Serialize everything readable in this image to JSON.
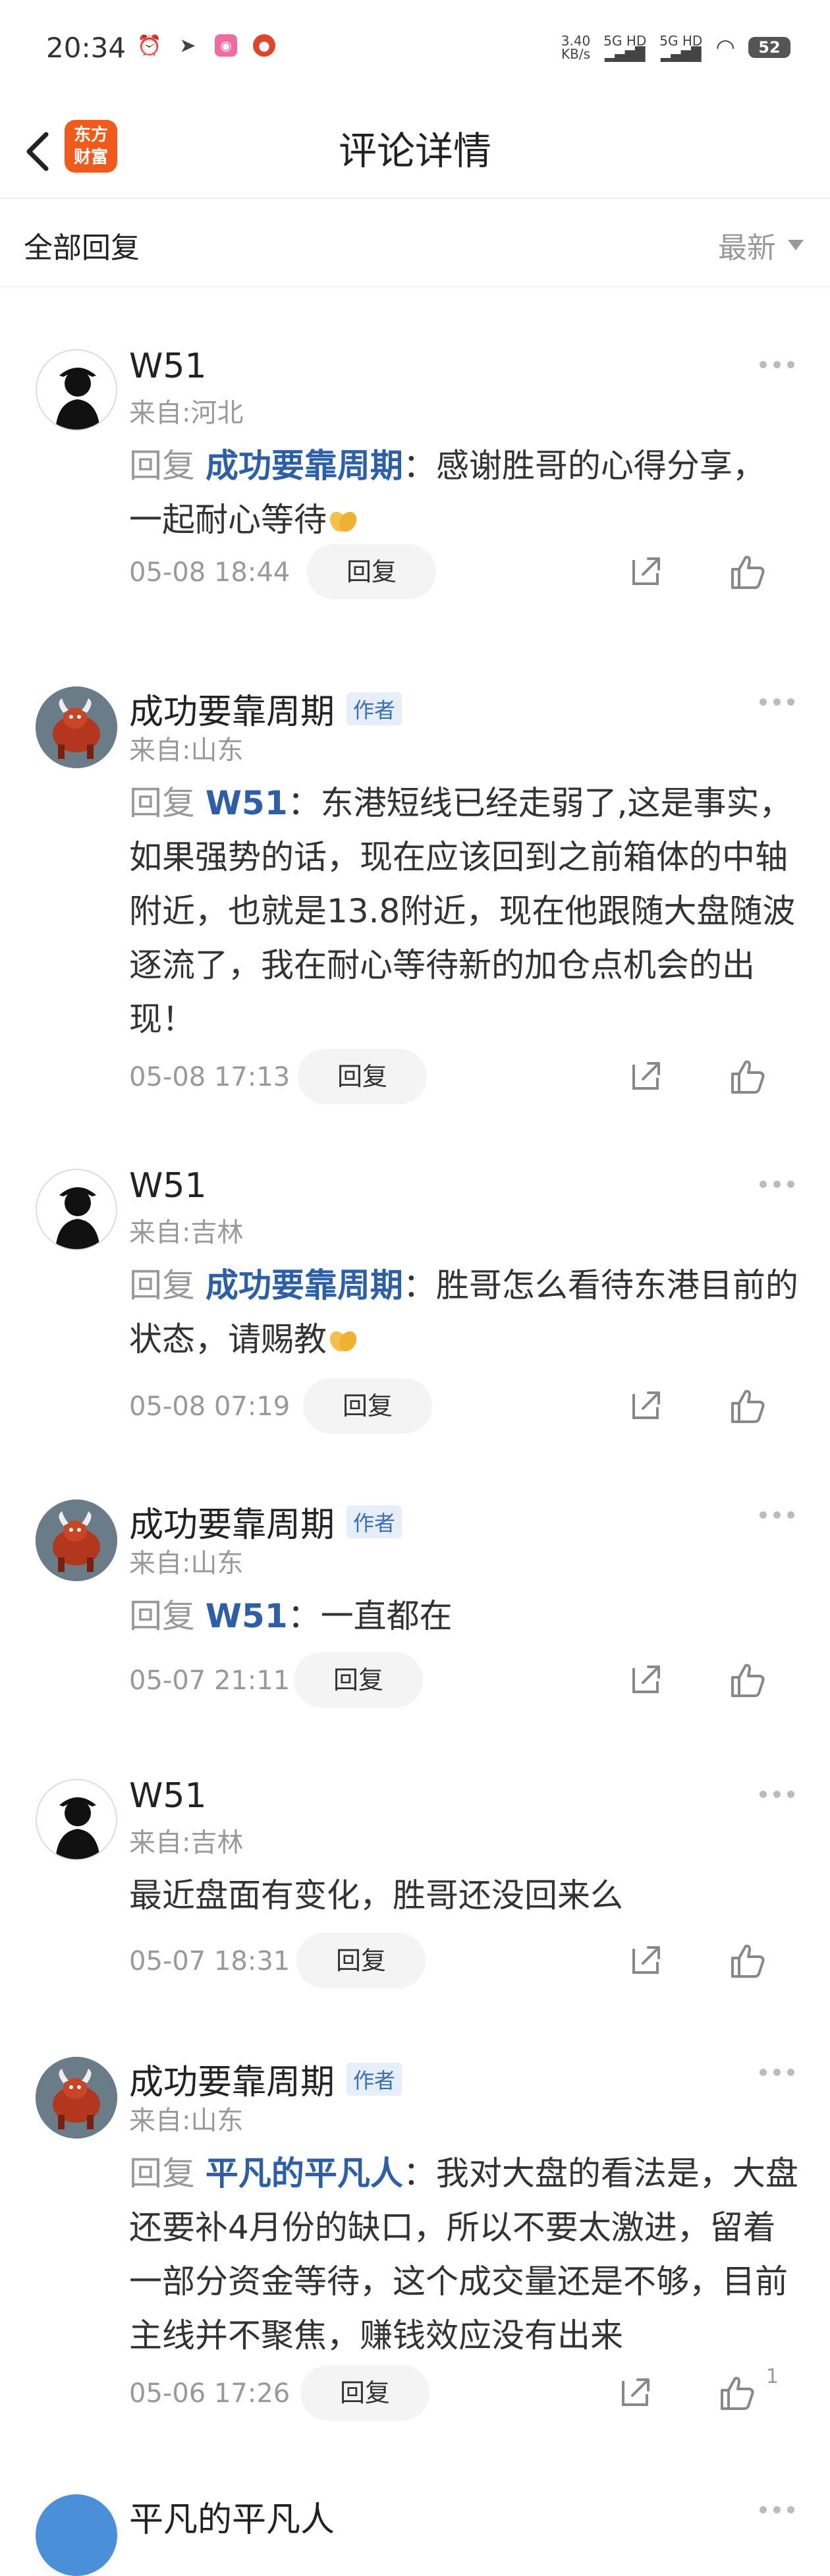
{
  "status_bar": {
    "time": "20:34",
    "speed_value": "3.40",
    "speed_unit": "KB/s",
    "net1": "5G HD",
    "net2": "5G HD",
    "battery": "52"
  },
  "nav": {
    "title": "评论详情",
    "logo_line1": "东方",
    "logo_line2": "财富"
  },
  "section": {
    "title": "全部回复",
    "sort_label": "最新"
  },
  "comments": [
    {
      "user": "W51",
      "author_badge": "",
      "location": "来自:河北",
      "reply_prefix": "回复",
      "reply_to": "成功要靠周期",
      "sep": "：",
      "text_part1": "感谢胜哥的心得分享，",
      "text_part2": "一起耐心等待",
      "date": "05-08 18:44",
      "reply_btn": "回复",
      "likes": ""
    },
    {
      "user": "成功要靠周期",
      "author_badge": "作者",
      "location": "来自:山东",
      "reply_prefix": "回复",
      "reply_to": "W51",
      "sep": "：",
      "text_part1": "东港短线已经走弱了,这是事实，如果强势的话，现在应该回到之前箱体的中轴附近，也就是13.8附近，现在他跟随大盘随波逐流了，我在耐心等待新的加仓点机会的出现！",
      "text_part2": "",
      "date": "05-08 17:13",
      "reply_btn": "回复",
      "likes": ""
    },
    {
      "user": "W51",
      "author_badge": "",
      "location": "来自:吉林",
      "reply_prefix": "回复",
      "reply_to": "成功要靠周期",
      "sep": "：",
      "text_part1": "胜哥怎么看待东港目前的状态，请赐教",
      "text_part2": "",
      "date": "05-08 07:19",
      "reply_btn": "回复",
      "likes": ""
    },
    {
      "user": "成功要靠周期",
      "author_badge": "作者",
      "location": "来自:山东",
      "reply_prefix": "回复",
      "reply_to": "W51",
      "sep": "：",
      "text_part1": "一直都在",
      "text_part2": "",
      "date": "05-07 21:11",
      "reply_btn": "回复",
      "likes": ""
    },
    {
      "user": "W51",
      "author_badge": "",
      "location": "来自:吉林",
      "reply_prefix": "",
      "reply_to": "",
      "sep": "",
      "text_part1": "最近盘面有变化，胜哥还没回来么",
      "text_part2": "",
      "date": "05-07 18:31",
      "reply_btn": "回复",
      "likes": ""
    },
    {
      "user": "成功要靠周期",
      "author_badge": "作者",
      "location": "来自:山东",
      "reply_prefix": "回复",
      "reply_to": "平凡的平凡人",
      "sep": "：",
      "text_part1": "我对大盘的看法是，大盘还要补4月份的缺口，所以不要太激进，留着一部分资金等待，这个成交量还是不够，目前主线并不聚焦，赚钱效应没有出来",
      "text_part2": "",
      "date": "05-06 17:26",
      "reply_btn": "回复",
      "likes": "1"
    },
    {
      "user": "平凡的平凡人",
      "author_badge": "",
      "location": "",
      "reply_prefix": "",
      "reply_to": "",
      "sep": "",
      "text_part1": "",
      "text_part2": "",
      "date": "",
      "reply_btn": "",
      "likes": ""
    }
  ],
  "icons": {
    "back": "back-arrow-icon",
    "share": "share-icon",
    "like": "thumbs-up-icon",
    "more": "more-dots-icon",
    "emoji": "praying-hands-emoji"
  },
  "colors": {
    "link": "#2c5fa8",
    "muted": "#999999",
    "badge_bg": "#e6eef9",
    "logo_bg": "#f05a1a"
  }
}
